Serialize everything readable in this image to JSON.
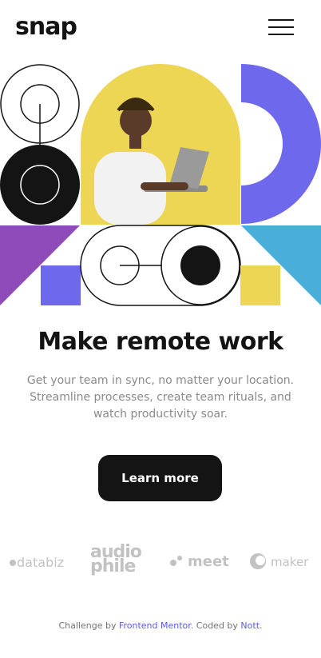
{
  "header": {
    "logo": "snap",
    "menu_icon": "hamburger-menu-icon"
  },
  "hero": {
    "headline": "Make remote work",
    "description": "Get your team in sync, no matter your location. Streamline processes, create team rituals, and watch productivity soar.",
    "cta_label": "Learn more",
    "image_alt": "Man using a laptop on yellow background"
  },
  "brands": {
    "databiz": "databiz",
    "audiophile_top": "audio",
    "audiophile_bottom": "phile",
    "meet": "meet",
    "maker": "maker"
  },
  "attribution": {
    "prefix": "Challenge by ",
    "challenge_link": "Frontend Mentor",
    "middle": ". Coded by ",
    "author_link": "Nott",
    "suffix": "."
  },
  "colors": {
    "purple": "#6e68ec",
    "violet": "#8f4bba",
    "cyan": "#4aaedb",
    "yellow": "#ecd653",
    "dark": "#141414"
  }
}
